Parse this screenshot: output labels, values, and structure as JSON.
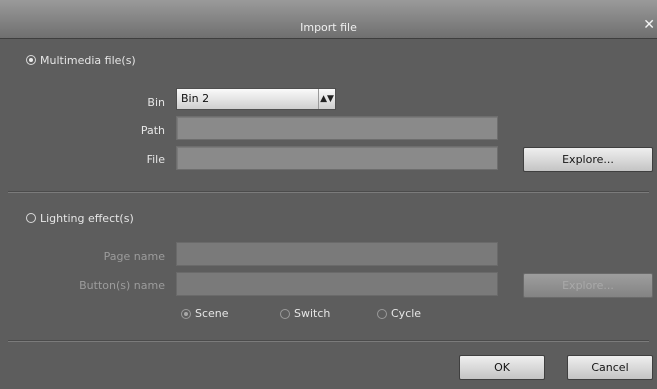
{
  "dialog": {
    "title": "Import file",
    "close_glyph": "✕"
  },
  "multimedia": {
    "option_label": "Multimedia file(s)",
    "selected": true,
    "bin_label": "Bin",
    "bin_value": "Bin 2",
    "path_label": "Path",
    "path_value": "",
    "file_label": "File",
    "file_value": "",
    "explore_label": "Explore..."
  },
  "lighting": {
    "option_label": "Lighting effect(s)",
    "selected": false,
    "page_name_label": "Page name",
    "page_name_value": "",
    "buttons_name_label": "Button(s) name",
    "buttons_name_value": "",
    "explore_label": "Explore...",
    "modes": [
      {
        "label": "Scene",
        "selected": true
      },
      {
        "label": "Switch",
        "selected": false
      },
      {
        "label": "Cycle",
        "selected": false
      }
    ]
  },
  "footer": {
    "ok_label": "OK",
    "cancel_label": "Cancel"
  },
  "icons": {
    "close": "close-icon",
    "select_arrows": "updown-arrows-icon"
  },
  "colors": {
    "background": "#5d5d5d",
    "titlebar": "#7f7f7f",
    "field": "#8a8a8a",
    "button": "#dcdcdc"
  }
}
